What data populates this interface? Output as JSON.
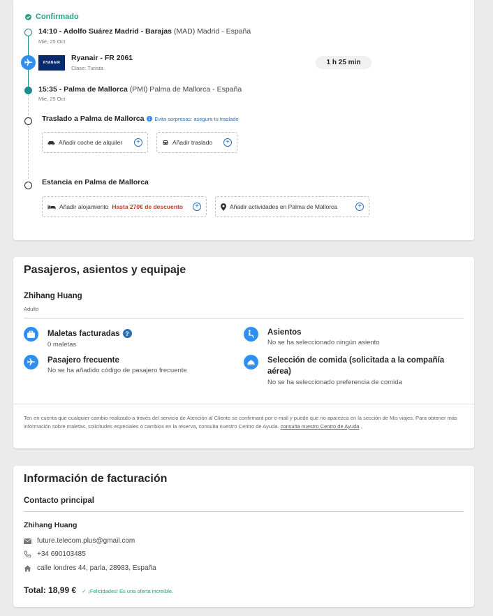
{
  "itinerary": {
    "status": "Confirmado",
    "departure": {
      "time_airport": "14:10 - Adolfo Suárez Madrid - Barajas",
      "code_place": "(MAD) Madrid - España",
      "date": "Mie, 25 Oct"
    },
    "flight": {
      "airline_logo_text": "RYANAIR",
      "name": "Ryanair - FR 2061",
      "class": "Clase: Turista",
      "duration": "1 h 25 min"
    },
    "arrival": {
      "time_airport": "15:35 - Palma de Mallorca",
      "code_place": "(PMI) Palma de Mallorca - España",
      "date": "Mie, 25 Oct"
    },
    "transfer": {
      "title": "Traslado a Palma de Mallorca",
      "note": "Evita sorpresas: asegura tu traslado",
      "options": [
        {
          "label": "Añadir coche de alquiler"
        },
        {
          "label": "Añadir traslado"
        }
      ]
    },
    "stay": {
      "title": "Estancia en Palma de Mallorca",
      "options": [
        {
          "label": "Añadir alojamiento",
          "highlight": "Hasta 270€ de descuento"
        },
        {
          "label": "Añadir actividades en Palma de Mallorca",
          "highlight": ""
        }
      ]
    }
  },
  "passengers": {
    "title": "Pasajeros, asientos y equipaje",
    "passenger": {
      "name": "Zhihang Huang",
      "type": "Adulto"
    },
    "features": [
      {
        "icon": "suitcase-icon",
        "title": "Maletas facturadas",
        "value": "0 maletas"
      },
      {
        "icon": "seat-icon",
        "title": "Asientos",
        "value": "No se ha seleccionado ningún asiento"
      },
      {
        "icon": "plane-icon",
        "title": "Pasajero frecuente",
        "value": "No se ha añadido código de pasajero frecuente"
      },
      {
        "icon": "meal-icon",
        "title": "Selección de comida (solicitada a la compañía aérea)",
        "value": "No se ha seleccionado preferencia de comida"
      }
    ],
    "disclaimer": "Ten en cuenta que cualquier cambio realizado a través del servicio de Atención al Cliente se confirmará por e-mail y puede que no aparezca en la sección de Mis viajes. Para obtener más información sobre maletas, solicitudes especiales o cambios en la reserva, consulta nuestro Centro de Ayuda.",
    "help_link": "consulta nuestro Centro de Ayuda",
    "help_link_end": "."
  },
  "billing": {
    "title": "Información de facturación",
    "contact_heading": "Contacto principal",
    "name": "Zhihang Huang",
    "email": "future.telecom.plus@gmail.com",
    "phone": "+34 690103485",
    "address": "calle londres 44, parla, 28983, España",
    "total_label": "Total: 18,99 €",
    "total_note": "¡Felicidades! Es una oferta increíble."
  },
  "colors": {
    "accent_blue": "#2e8ff0",
    "confirm_green": "#2a9d7f",
    "timeline_teal": "#1a8e8e",
    "discount_red": "#c0392b"
  }
}
